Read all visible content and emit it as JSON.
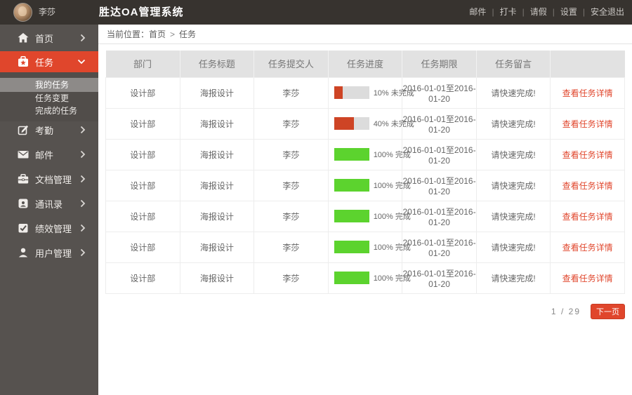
{
  "topbar": {
    "user_name": "李莎",
    "app_title": "胜达OA管理系统",
    "menu": [
      {
        "label": "邮件"
      },
      {
        "label": "打卡"
      },
      {
        "label": "请假"
      },
      {
        "label": "设置"
      },
      {
        "label": "安全退出"
      }
    ]
  },
  "sidebar": {
    "items": [
      {
        "label": "首页",
        "icon": "home-icon",
        "chevron": "right"
      },
      {
        "label": "任务",
        "icon": "task-icon",
        "chevron": "down",
        "active": true
      },
      {
        "label": "考勤",
        "icon": "attendance-icon",
        "chevron": "right"
      },
      {
        "label": "邮件",
        "icon": "mail-icon",
        "chevron": "right"
      },
      {
        "label": "文档管理",
        "icon": "documents-icon",
        "chevron": "right"
      },
      {
        "label": "通讯录",
        "icon": "contacts-icon",
        "chevron": "right"
      },
      {
        "label": "绩效管理",
        "icon": "performance-icon",
        "chevron": "right"
      },
      {
        "label": "用户管理",
        "icon": "users-icon",
        "chevron": "right"
      }
    ],
    "task_submenu": [
      {
        "label": "我的任务",
        "selected": true
      },
      {
        "label": "任务变更",
        "selected": false
      },
      {
        "label": "完成的任务",
        "selected": false
      }
    ]
  },
  "breadcrumb": {
    "prefix": "当前位置：",
    "home": "首页",
    "separator": ">",
    "current": "任务"
  },
  "table": {
    "headers": [
      "部门",
      "任务标题",
      "任务提交人",
      "任务进度",
      "任务期限",
      "任务留言",
      ""
    ],
    "rows": [
      {
        "dept": "设计部",
        "title": "海报设计",
        "submitter": "李莎",
        "progress": {
          "percent": 10,
          "percent_text": "10%",
          "status": "未完成",
          "fill_pct": 24,
          "color": "#ce4425"
        },
        "deadline": "2016-01-01至2016-01-20",
        "message": "请快速完成!",
        "detail_link": "查看任务详情"
      },
      {
        "dept": "设计部",
        "title": "海报设计",
        "submitter": "李莎",
        "progress": {
          "percent": 40,
          "percent_text": "40%",
          "status": "未完成",
          "fill_pct": 57,
          "color": "#ce4425"
        },
        "deadline": "2016-01-01至2016-01-20",
        "message": "请快速完成!",
        "detail_link": "查看任务详情"
      },
      {
        "dept": "设计部",
        "title": "海报设计",
        "submitter": "李莎",
        "progress": {
          "percent": 100,
          "percent_text": "100%",
          "status": "完成",
          "fill_pct": 100,
          "color": "#5cd32e"
        },
        "deadline": "2016-01-01至2016-01-20",
        "message": "请快速完成!",
        "detail_link": "查看任务详情"
      },
      {
        "dept": "设计部",
        "title": "海报设计",
        "submitter": "李莎",
        "progress": {
          "percent": 100,
          "percent_text": "100%",
          "status": "完成",
          "fill_pct": 100,
          "color": "#5cd32e"
        },
        "deadline": "2016-01-01至2016-01-20",
        "message": "请快速完成!",
        "detail_link": "查看任务详情"
      },
      {
        "dept": "设计部",
        "title": "海报设计",
        "submitter": "李莎",
        "progress": {
          "percent": 100,
          "percent_text": "100%",
          "status": "完成",
          "fill_pct": 100,
          "color": "#5cd32e"
        },
        "deadline": "2016-01-01至2016-01-20",
        "message": "请快速完成!",
        "detail_link": "查看任务详情"
      },
      {
        "dept": "设计部",
        "title": "海报设计",
        "submitter": "李莎",
        "progress": {
          "percent": 100,
          "percent_text": "100%",
          "status": "完成",
          "fill_pct": 100,
          "color": "#5cd32e"
        },
        "deadline": "2016-01-01至2016-01-20",
        "message": "请快速完成!",
        "detail_link": "查看任务详情"
      },
      {
        "dept": "设计部",
        "title": "海报设计",
        "submitter": "李莎",
        "progress": {
          "percent": 100,
          "percent_text": "100%",
          "status": "完成",
          "fill_pct": 100,
          "color": "#5cd32e"
        },
        "deadline": "2016-01-01至2016-01-20",
        "message": "请快速完成!",
        "detail_link": "查看任务详情"
      }
    ]
  },
  "pagination": {
    "current": "1",
    "separator": "/",
    "total": "29",
    "next_label": "下一页"
  },
  "colors": {
    "accent_red": "#e0462c",
    "progress_red": "#ce4425",
    "progress_green": "#5cd32e",
    "topbar_bg": "#37332f",
    "sidebar_bg": "#56524f",
    "header_row_bg": "#e2e2e2"
  }
}
